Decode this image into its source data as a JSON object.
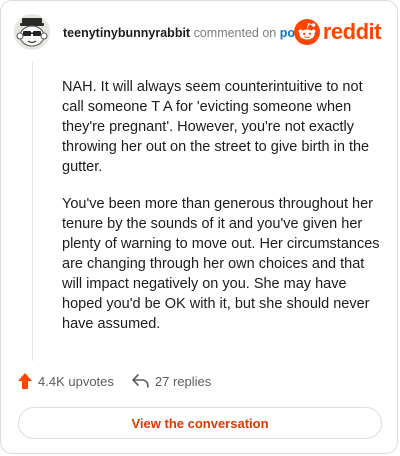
{
  "header": {
    "username": "teenytinybunnyrabbit",
    "action_text": "commented on",
    "post_link": "post",
    "brand": "reddit"
  },
  "comment": {
    "paragraphs": [
      "NAH. It will always seem counterintuitive to not call someone T A for 'evicting someone when they're pregnant'. However, you're not exactly throwing her out on the street to give birth in the gutter.",
      "You've been more than generous throughout her tenure by the sounds of it and you've given her plenty of warning to move out. Her circumstances are changing through her own choices and that will impact negatively on you. She may have hoped you'd be OK with it, but she should never have assumed."
    ]
  },
  "stats": {
    "upvotes": "4.4K upvotes",
    "replies": "27 replies"
  },
  "cta": {
    "label": "View the conversation"
  },
  "colors": {
    "brand": "#ff4500",
    "link": "#0079d3",
    "cta_text": "#d93a00",
    "muted": "#7c7c7c"
  },
  "icons": {
    "upvote": "upvote-arrow-icon",
    "reply": "reply-arrow-icon",
    "brand": "reddit-snoo-icon",
    "avatar": "snoo-avatar"
  }
}
